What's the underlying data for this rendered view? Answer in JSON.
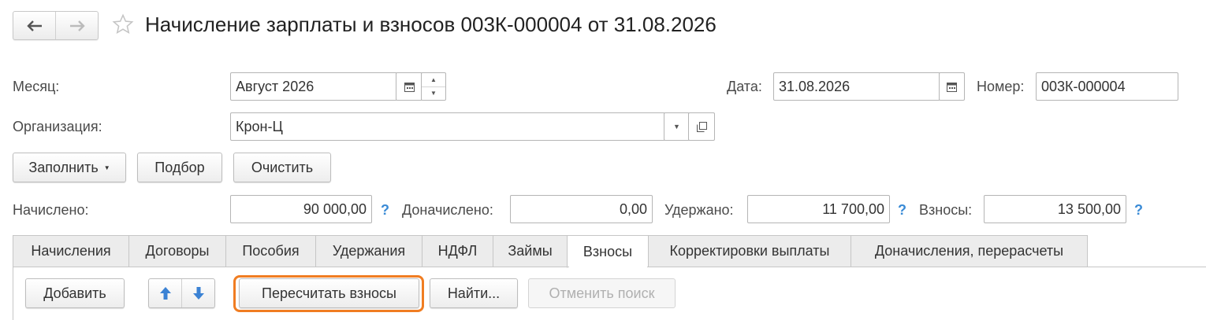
{
  "header": {
    "back_icon": "arrow-left-icon",
    "forward_icon": "arrow-right-icon",
    "favorite_icon": "star-icon",
    "title": "Начисление зарплаты и взносов 003К-000004 от 31.08.2026"
  },
  "form": {
    "month_label": "Месяц:",
    "month_value": "Август 2026",
    "date_label": "Дата:",
    "date_value": "31.08.2026",
    "number_label": "Номер:",
    "number_value": "003К-000004",
    "org_label": "Организация:",
    "org_value": "Крон-Ц"
  },
  "toolbar": {
    "fill_label": "Заполнить",
    "pick_label": "Подбор",
    "clear_label": "Очистить"
  },
  "totals": {
    "accrued_label": "Начислено:",
    "accrued_value": "90 000,00",
    "additional_label": "Доначислено:",
    "additional_value": "0,00",
    "withheld_label": "Удержано:",
    "withheld_value": "11 700,00",
    "contributions_label": "Взносы:",
    "contributions_value": "13 500,00",
    "help_mark": "?"
  },
  "tabs": [
    {
      "label": "Начисления",
      "active": false
    },
    {
      "label": "Договоры",
      "active": false
    },
    {
      "label": "Пособия",
      "active": false
    },
    {
      "label": "Удержания",
      "active": false
    },
    {
      "label": "НДФЛ",
      "active": false
    },
    {
      "label": "Займы",
      "active": false
    },
    {
      "label": "Взносы",
      "active": true
    },
    {
      "label": "Корректировки выплаты",
      "active": false
    },
    {
      "label": "Доначисления, перерасчеты",
      "active": false
    }
  ],
  "tab_toolbar": {
    "add_label": "Добавить",
    "recalc_label": "Пересчитать взносы",
    "find_label": "Найти...",
    "cancel_search_label": "Отменить поиск"
  },
  "colors": {
    "highlight": "#f07d22",
    "accent_blue": "#3b82d4"
  }
}
